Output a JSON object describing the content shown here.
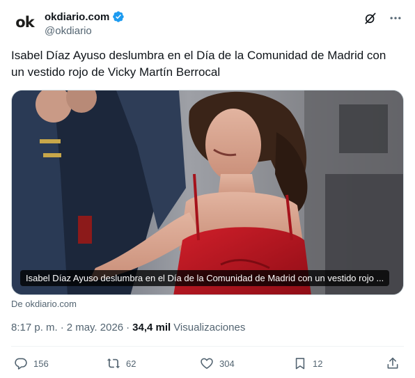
{
  "account": {
    "display_name": "okdiario.com",
    "handle": "@okdiario",
    "avatar_text_o": "o",
    "avatar_text_k": "k"
  },
  "tweet": {
    "text": "Isabel Díaz Ayuso deslumbra en el Día de la Comunidad de Madrid con un vestido rojo de Vicky Martín Berrocal"
  },
  "card": {
    "title": "Isabel Díaz Ayuso deslumbra en el Día de la Comunidad de Madrid con un vestido rojo ...",
    "source": "De okdiario.com"
  },
  "meta": {
    "time": "8:17 p. m.",
    "separator": "·",
    "date": "2 may. 2026",
    "separator2": "·",
    "views_count": "34,4 mil",
    "views_label": "Visualizaciones"
  },
  "actions": {
    "replies": "156",
    "reposts": "62",
    "likes": "304",
    "bookmarks": "12"
  },
  "colors": {
    "text_primary": "#0f1419",
    "text_secondary": "#536471",
    "verified": "#1d9bf0",
    "dress": "#b3121c"
  },
  "icons": [
    "verified-badge-icon",
    "grok-icon",
    "more-icon",
    "reply-icon",
    "repost-icon",
    "like-icon",
    "bookmark-icon",
    "share-icon"
  ]
}
